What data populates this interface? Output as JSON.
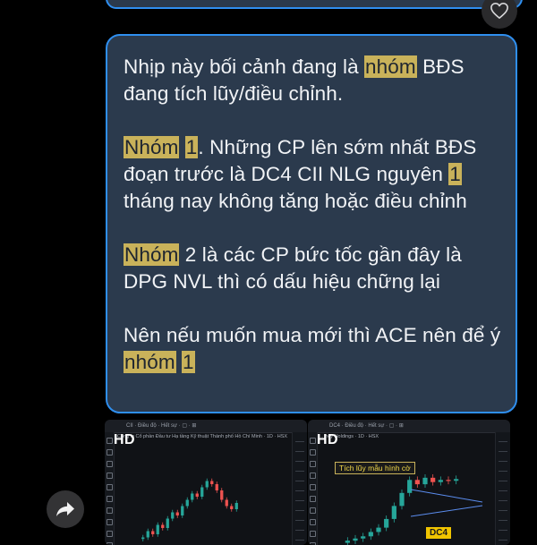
{
  "message": {
    "paragraphs": [
      [
        {
          "t": "Nhịp này bối cảnh đang là "
        },
        {
          "t": "nhóm",
          "hl": true
        },
        {
          "t": " BĐS đang tích lũy/điều chỉnh."
        }
      ],
      [
        {
          "t": "Nhóm",
          "hl": true
        },
        {
          "t": " "
        },
        {
          "t": "1",
          "hl": true
        },
        {
          "t": ". Những CP lên sớm nhất BĐS đoạn trước là DC4 CII NLG nguyên "
        },
        {
          "t": "1",
          "hl": true
        },
        {
          "t": " tháng nay không tăng hoặc điều chỉnh"
        }
      ],
      [
        {
          "t": "Nhóm",
          "hl": true
        },
        {
          "t": " 2 là các CP bức tốc gần đây là DPG NVL thì có dấu hiệu chững lại"
        }
      ],
      [
        {
          "t": "Nên nếu muốn mua mới thì ACE nên để ý "
        },
        {
          "t": "nhóm",
          "hl": true
        },
        {
          "t": " "
        },
        {
          "t": "1",
          "hl": true
        }
      ]
    ]
  },
  "attachments": [
    {
      "badge": "HD",
      "toolbar": "CII   ·   Điều độ   ·   Hết sự   ·   ▢   ·   ⊞",
      "symbol_line": "Công ty Cổ phần Đầu tư Hạ tầng Kỹ thuật Thành phố Hồ Chí Minh · 1D · HSX",
      "chart_data": {
        "type": "candlestick",
        "title": "",
        "series": [
          {
            "name": "",
            "values": [
              18,
              20,
              19,
              22,
              21,
              24,
              26,
              25,
              28,
              30,
              32,
              31,
              34,
              36,
              35,
              33,
              30,
              28,
              27,
              29
            ]
          }
        ]
      }
    },
    {
      "badge": "HD",
      "toolbar": "DC4   ·   Điều độ   ·   Hết sự   ·   ▢   ·   ⊞",
      "symbol_line": "…ncy Holdings · 1D · HSX",
      "annotation": "Tích lũy mẫu hình cờ",
      "ticker_label": "DC4",
      "chart_data": {
        "type": "candlestick",
        "title": "",
        "series": [
          {
            "name": "",
            "values": [
              10,
              10.5,
              11,
              12,
              13,
              15,
              18,
              21,
              24,
              23,
              24.5,
              23.5,
              24,
              23.8,
              24.2
            ]
          }
        ]
      }
    }
  ],
  "icons": {
    "like": "heart-outline-icon",
    "share": "share-arrow-icon"
  },
  "colors": {
    "bubble_bg": "#2b3a4d",
    "bubble_border": "#2f8ff0",
    "highlight": "#c9b25a",
    "candle_up": "#26a69a",
    "candle_down": "#ef5350"
  }
}
